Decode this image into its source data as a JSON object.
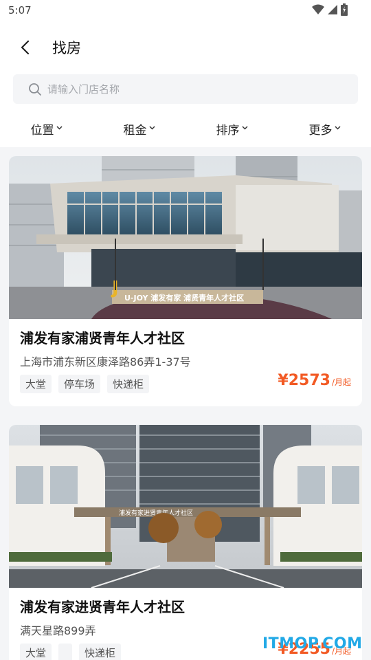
{
  "status_bar": {
    "time": "5:07"
  },
  "header": {
    "title": "找房"
  },
  "search": {
    "placeholder": "请输入门店名称"
  },
  "filters": [
    {
      "label": "位置"
    },
    {
      "label": "租金"
    },
    {
      "label": "排序"
    },
    {
      "label": "更多"
    }
  ],
  "listings": [
    {
      "name": "浦发有家浦贤青年人才社区",
      "address": "上海市浦东新区康泽路86弄1-37号",
      "tags": [
        "大堂",
        "停车场",
        "快递柜"
      ],
      "price": "¥2573",
      "price_unit": "/月起",
      "sign_text": "U-JOY 浦发有家 浦贤青年人才社区"
    },
    {
      "name": "浦发有家进贤青年人才社区",
      "address": "满天星路899弄",
      "tags": [
        "大堂",
        "",
        "快递柜"
      ],
      "price": "¥2255",
      "price_unit": "/月起",
      "sign_text": "浦发有家进贤青年人才社区"
    }
  ],
  "watermark": "ITMOP.COM",
  "colors": {
    "accent": "#f25a24",
    "watermark": "#22a9e6",
    "background": "#f4f5f7"
  }
}
